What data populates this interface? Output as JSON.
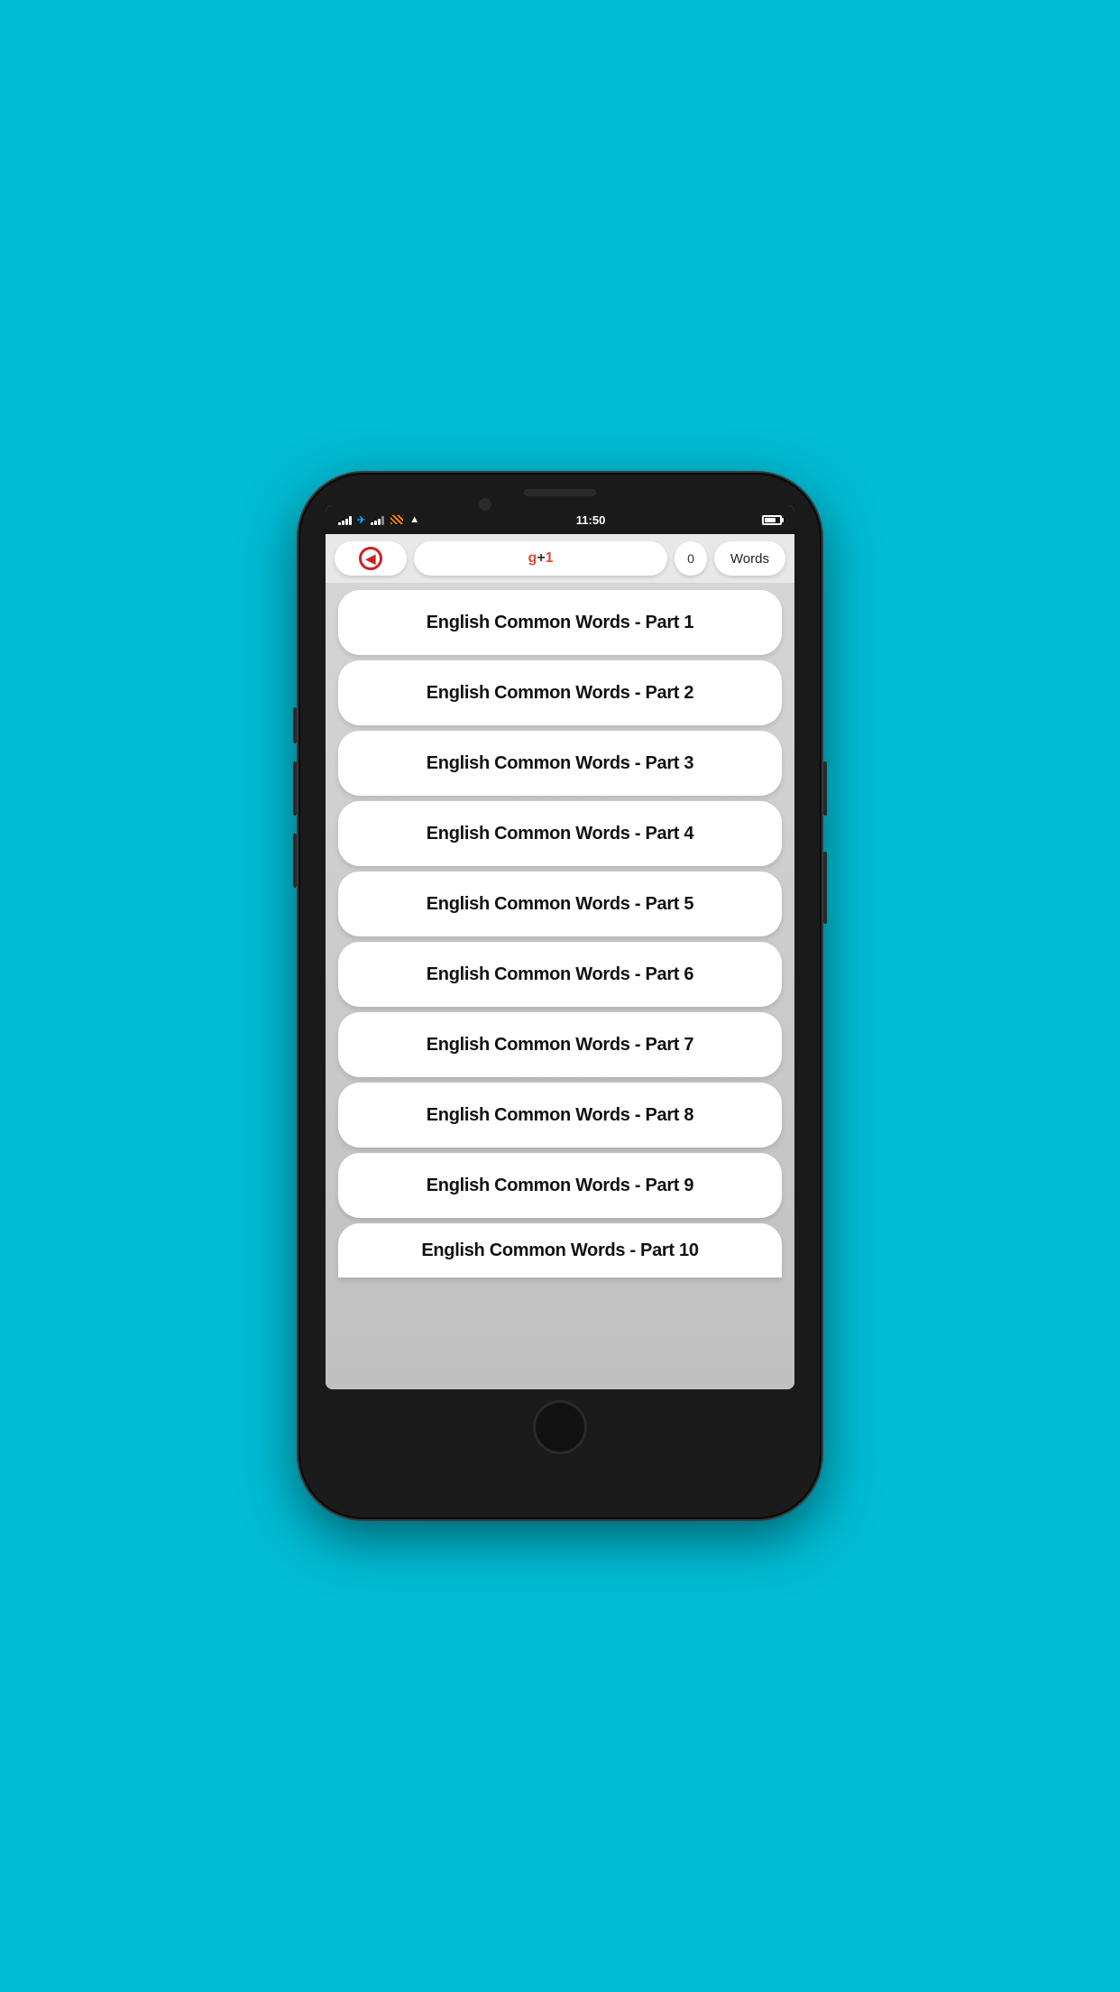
{
  "status_bar": {
    "time": "11:50",
    "signal_label": "signal",
    "wifi_label": "wifi"
  },
  "toolbar": {
    "back_label": "◀",
    "gplus_g": "g",
    "gplus_plus": "+",
    "gplus_one": "1",
    "count": "0",
    "words_label": "Words"
  },
  "list": {
    "items": [
      {
        "label": "English Common Words - Part 1"
      },
      {
        "label": "English Common Words - Part 2"
      },
      {
        "label": "English Common Words - Part 3"
      },
      {
        "label": "English Common Words - Part 4"
      },
      {
        "label": "English Common Words - Part 5"
      },
      {
        "label": "English Common Words - Part 6"
      },
      {
        "label": "English Common Words - Part 7"
      },
      {
        "label": "English Common Words - Part 8"
      },
      {
        "label": "English Common Words - Part 9"
      },
      {
        "label": "English Common Words - Part 10"
      }
    ]
  }
}
